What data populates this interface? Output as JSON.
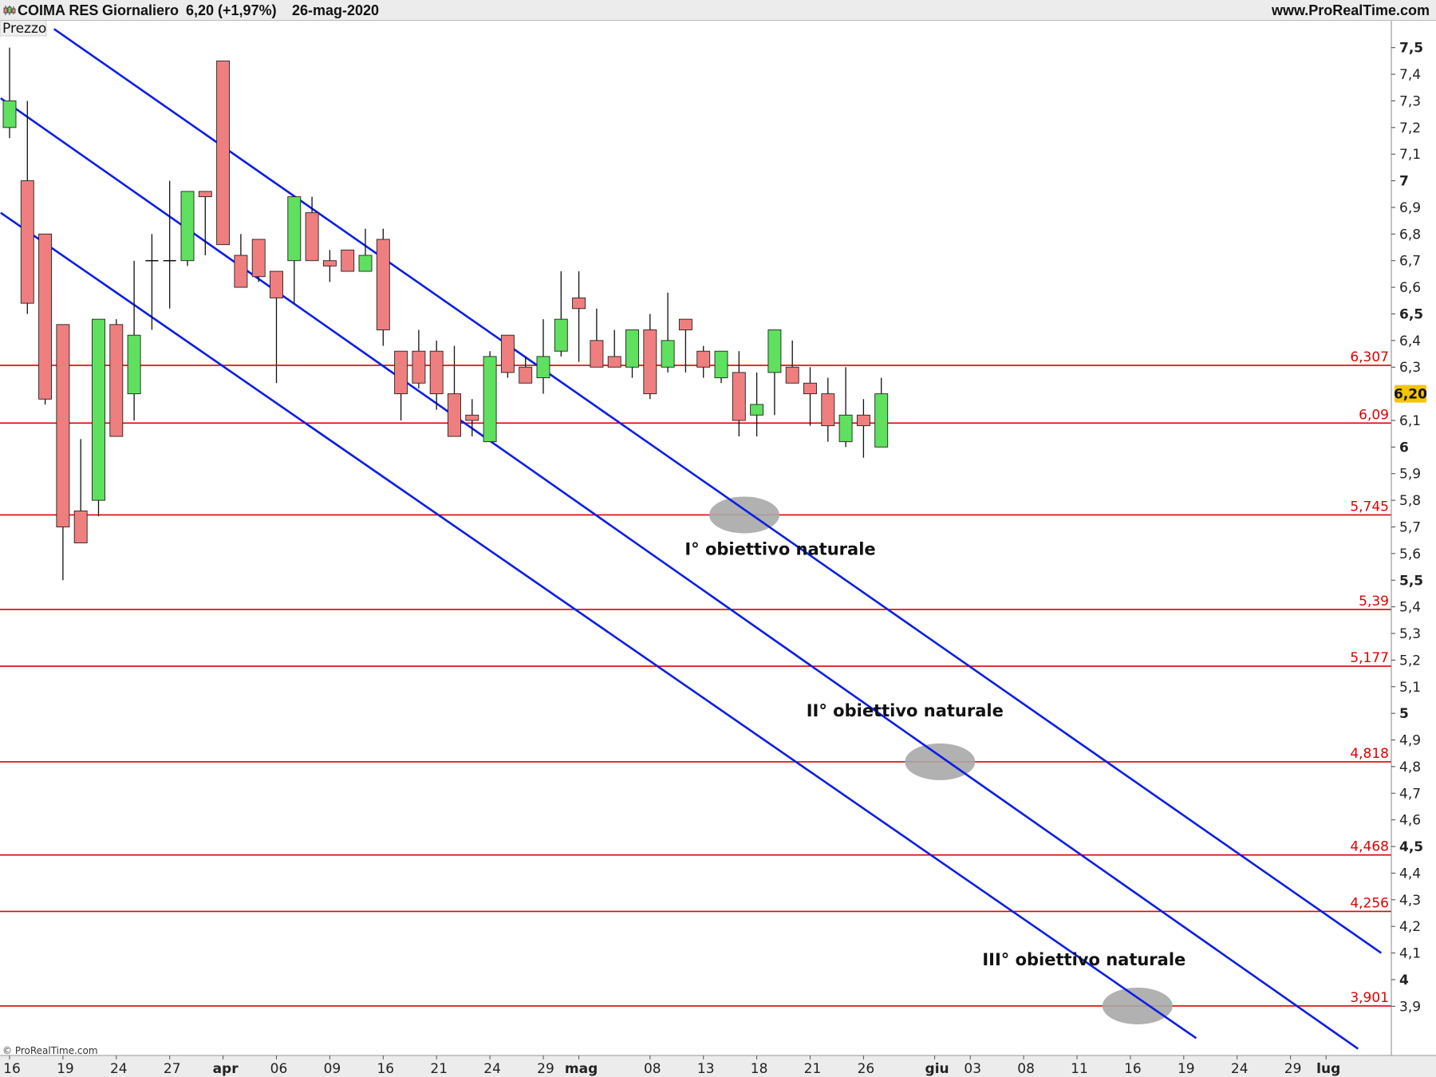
{
  "header": {
    "ticker": "COIMA RES",
    "period": "Giornaliero",
    "last": "6,20 (+1,97%)",
    "date": "26-mag-2020",
    "site": "www.ProRealTime.com"
  },
  "pane_label": "Prezzo",
  "watermark": "© ProRealTime.com",
  "colors": {
    "up": "#5fe05f",
    "down": "#ef7f7f",
    "level": "#e00000",
    "channel": "#0a1ee6",
    "target": "#a8a8a8",
    "current": "#f5c400"
  },
  "chart_data": {
    "type": "candlestick",
    "y_range": [
      3.85,
      7.55
    ],
    "y_ticks": [
      {
        "value": 7.5,
        "label": "7,5",
        "major": true
      },
      {
        "value": 7.4,
        "label": "7,4"
      },
      {
        "value": 7.3,
        "label": "7,3"
      },
      {
        "value": 7.2,
        "label": "7,2"
      },
      {
        "value": 7.1,
        "label": "7,1"
      },
      {
        "value": 7.0,
        "label": "7",
        "major": true
      },
      {
        "value": 6.9,
        "label": "6,9"
      },
      {
        "value": 6.8,
        "label": "6,8"
      },
      {
        "value": 6.7,
        "label": "6,7"
      },
      {
        "value": 6.6,
        "label": "6,6"
      },
      {
        "value": 6.5,
        "label": "6,5",
        "major": true
      },
      {
        "value": 6.4,
        "label": "6,4"
      },
      {
        "value": 6.3,
        "label": "6,3"
      },
      {
        "value": 6.1,
        "label": "6,1"
      },
      {
        "value": 6.0,
        "label": "6",
        "major": true
      },
      {
        "value": 5.9,
        "label": "5,9"
      },
      {
        "value": 5.8,
        "label": "5,8"
      },
      {
        "value": 5.7,
        "label": "5,7"
      },
      {
        "value": 5.6,
        "label": "5,6"
      },
      {
        "value": 5.5,
        "label": "5,5",
        "major": true
      },
      {
        "value": 5.4,
        "label": "5,4"
      },
      {
        "value": 5.3,
        "label": "5,3"
      },
      {
        "value": 5.2,
        "label": "5,2"
      },
      {
        "value": 5.1,
        "label": "5,1"
      },
      {
        "value": 5.0,
        "label": "5",
        "major": true
      },
      {
        "value": 4.9,
        "label": "4,9"
      },
      {
        "value": 4.8,
        "label": "4,8"
      },
      {
        "value": 4.7,
        "label": "4,7"
      },
      {
        "value": 4.6,
        "label": "4,6"
      },
      {
        "value": 4.5,
        "label": "4,5",
        "major": true
      },
      {
        "value": 4.4,
        "label": "4,4"
      },
      {
        "value": 4.3,
        "label": "4,3"
      },
      {
        "value": 4.2,
        "label": "4,2"
      },
      {
        "value": 4.1,
        "label": "4,1"
      },
      {
        "value": 4.0,
        "label": "4",
        "major": true
      },
      {
        "value": 3.9,
        "label": "3,9"
      }
    ],
    "current_price": {
      "value": 6.2,
      "label": "6,20"
    },
    "x_ticks": [
      {
        "label": "16",
        "index": 0
      },
      {
        "label": "19",
        "index": 3
      },
      {
        "label": "24",
        "index": 6
      },
      {
        "label": "27",
        "index": 9
      },
      {
        "label": "apr",
        "index": 12,
        "month": true
      },
      {
        "label": "06",
        "index": 15
      },
      {
        "label": "09",
        "index": 18
      },
      {
        "label": "16",
        "index": 21
      },
      {
        "label": "21",
        "index": 24
      },
      {
        "label": "24",
        "index": 27
      },
      {
        "label": "29",
        "index": 30
      },
      {
        "label": "mag",
        "index": 32,
        "month": true
      },
      {
        "label": "08",
        "index": 36
      },
      {
        "label": "13",
        "index": 39
      },
      {
        "label": "18",
        "index": 42
      },
      {
        "label": "21",
        "index": 45
      },
      {
        "label": "26",
        "index": 48
      },
      {
        "label": "giu",
        "index": 52,
        "month": true
      },
      {
        "label": "03",
        "index": 54
      },
      {
        "label": "08",
        "index": 57
      },
      {
        "label": "11",
        "index": 60
      },
      {
        "label": "16",
        "index": 63
      },
      {
        "label": "19",
        "index": 66
      },
      {
        "label": "24",
        "index": 69
      },
      {
        "label": "29",
        "index": 72
      },
      {
        "label": "lug",
        "index": 74,
        "month": true
      }
    ],
    "candles": [
      {
        "o": 7.2,
        "h": 7.5,
        "l": 7.16,
        "c": 7.3
      },
      {
        "o": 7.0,
        "h": 7.3,
        "l": 6.5,
        "c": 6.54
      },
      {
        "o": 6.8,
        "h": 6.8,
        "l": 6.16,
        "c": 6.18
      },
      {
        "o": 6.46,
        "h": 6.46,
        "l": 5.5,
        "c": 5.7
      },
      {
        "o": 5.76,
        "h": 6.03,
        "l": 5.64,
        "c": 5.64
      },
      {
        "o": 5.8,
        "h": 6.48,
        "l": 5.74,
        "c": 6.48
      },
      {
        "o": 6.46,
        "h": 6.48,
        "l": 6.04,
        "c": 6.04
      },
      {
        "o": 6.2,
        "h": 6.7,
        "l": 6.1,
        "c": 6.42
      },
      {
        "o": 6.7,
        "h": 6.8,
        "l": 6.44,
        "c": 6.7
      },
      {
        "o": 6.7,
        "h": 7.0,
        "l": 6.52,
        "c": 6.7
      },
      {
        "o": 6.7,
        "h": 6.96,
        "l": 6.68,
        "c": 6.96
      },
      {
        "o": 6.96,
        "h": 6.96,
        "l": 6.72,
        "c": 6.94
      },
      {
        "o": 7.45,
        "h": 7.45,
        "l": 6.76,
        "c": 6.76
      },
      {
        "o": 6.72,
        "h": 6.8,
        "l": 6.6,
        "c": 6.6
      },
      {
        "o": 6.78,
        "h": 6.78,
        "l": 6.62,
        "c": 6.64
      },
      {
        "o": 6.66,
        "h": 6.66,
        "l": 6.24,
        "c": 6.56
      },
      {
        "o": 6.7,
        "h": 6.94,
        "l": 6.54,
        "c": 6.94
      },
      {
        "o": 6.88,
        "h": 6.94,
        "l": 6.7,
        "c": 6.7
      },
      {
        "o": 6.7,
        "h": 6.74,
        "l": 6.62,
        "c": 6.68
      },
      {
        "o": 6.74,
        "h": 6.74,
        "l": 6.66,
        "c": 6.66
      },
      {
        "o": 6.66,
        "h": 6.82,
        "l": 6.66,
        "c": 6.72
      },
      {
        "o": 6.78,
        "h": 6.82,
        "l": 6.38,
        "c": 6.44
      },
      {
        "o": 6.36,
        "h": 6.36,
        "l": 6.1,
        "c": 6.2
      },
      {
        "o": 6.36,
        "h": 6.44,
        "l": 6.22,
        "c": 6.24
      },
      {
        "o": 6.36,
        "h": 6.4,
        "l": 6.14,
        "c": 6.2
      },
      {
        "o": 6.2,
        "h": 6.38,
        "l": 6.04,
        "c": 6.04
      },
      {
        "o": 6.12,
        "h": 6.18,
        "l": 6.04,
        "c": 6.1
      },
      {
        "o": 6.02,
        "h": 6.36,
        "l": 6.02,
        "c": 6.34
      },
      {
        "o": 6.42,
        "h": 6.42,
        "l": 6.26,
        "c": 6.28
      },
      {
        "o": 6.3,
        "h": 6.34,
        "l": 6.24,
        "c": 6.24
      },
      {
        "o": 6.26,
        "h": 6.48,
        "l": 6.2,
        "c": 6.34
      },
      {
        "o": 6.36,
        "h": 6.66,
        "l": 6.34,
        "c": 6.48
      },
      {
        "o": 6.56,
        "h": 6.66,
        "l": 6.32,
        "c": 6.52
      },
      {
        "o": 6.4,
        "h": 6.52,
        "l": 6.3,
        "c": 6.3
      },
      {
        "o": 6.34,
        "h": 6.44,
        "l": 6.3,
        "c": 6.3
      },
      {
        "o": 6.3,
        "h": 6.44,
        "l": 6.26,
        "c": 6.44
      },
      {
        "o": 6.44,
        "h": 6.5,
        "l": 6.18,
        "c": 6.2
      },
      {
        "o": 6.3,
        "h": 6.58,
        "l": 6.28,
        "c": 6.4
      },
      {
        "o": 6.48,
        "h": 6.48,
        "l": 6.28,
        "c": 6.44
      },
      {
        "o": 6.36,
        "h": 6.38,
        "l": 6.26,
        "c": 6.3
      },
      {
        "o": 6.26,
        "h": 6.36,
        "l": 6.24,
        "c": 6.36
      },
      {
        "o": 6.28,
        "h": 6.36,
        "l": 6.04,
        "c": 6.1
      },
      {
        "o": 6.12,
        "h": 6.28,
        "l": 6.04,
        "c": 6.16
      },
      {
        "o": 6.28,
        "h": 6.44,
        "l": 6.12,
        "c": 6.44
      },
      {
        "o": 6.3,
        "h": 6.4,
        "l": 6.24,
        "c": 6.24
      },
      {
        "o": 6.24,
        "h": 6.3,
        "l": 6.08,
        "c": 6.2
      },
      {
        "o": 6.2,
        "h": 6.26,
        "l": 6.02,
        "c": 6.08
      },
      {
        "o": 6.02,
        "h": 6.3,
        "l": 6.0,
        "c": 6.12
      },
      {
        "o": 6.12,
        "h": 6.18,
        "l": 5.96,
        "c": 6.08
      },
      {
        "o": 6.0,
        "h": 6.26,
        "l": 6.0,
        "c": 6.2
      }
    ],
    "levels": [
      {
        "value": 6.307,
        "label": "6,307"
      },
      {
        "value": 6.09,
        "label": "6,09"
      },
      {
        "value": 5.745,
        "label": "5,745"
      },
      {
        "value": 5.39,
        "label": "5,39"
      },
      {
        "value": 5.177,
        "label": "5,177"
      },
      {
        "value": 4.818,
        "label": "4,818"
      },
      {
        "value": 4.468,
        "label": "4,468"
      },
      {
        "value": 4.256,
        "label": "4,256"
      },
      {
        "value": 3.901,
        "label": "3,901"
      }
    ],
    "channel_lines": [
      {
        "start": {
          "index": 2.5,
          "value": 7.57
        },
        "end": {
          "index": 77.1,
          "value": 4.1
        }
      },
      {
        "start": {
          "index": -0.5,
          "value": 7.31
        },
        "end": {
          "index": 75.8,
          "value": 3.74
        }
      },
      {
        "start": {
          "index": -0.5,
          "value": 6.88
        },
        "end": {
          "index": 66.7,
          "value": 3.78
        }
      }
    ],
    "targets": [
      {
        "index": 41.3,
        "value": 5.745,
        "label": "I° obiettivo naturale"
      },
      {
        "index": 52.3,
        "value": 4.818,
        "label": "II° obiettivo naturale"
      },
      {
        "index": 63.4,
        "value": 3.901,
        "label": "III° obiettivo naturale"
      }
    ]
  }
}
